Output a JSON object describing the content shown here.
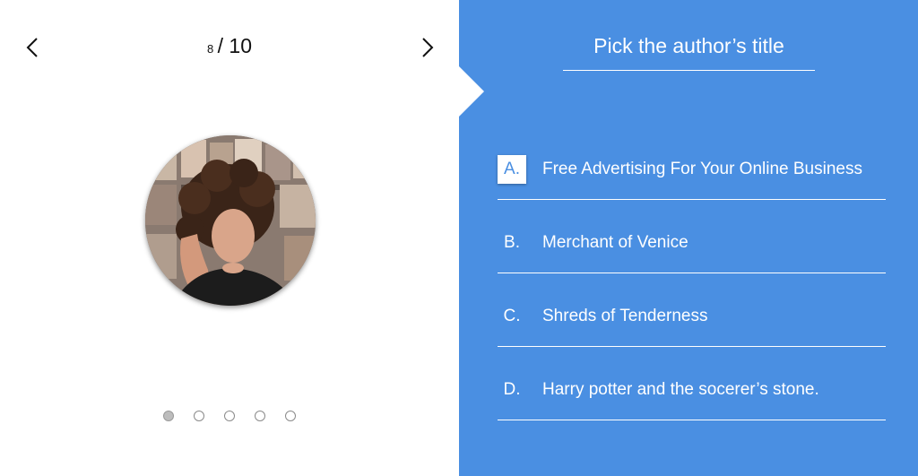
{
  "pager": {
    "current": "8",
    "total": "/ 10"
  },
  "question": {
    "title": "Pick the author’s title"
  },
  "options": [
    {
      "letter": "A.",
      "text": "Free Advertising For Your Online Business",
      "selected": true
    },
    {
      "letter": "B.",
      "text": "Merchant of Venice",
      "selected": false
    },
    {
      "letter": "C.",
      "text": "Shreds of Tenderness",
      "selected": false
    },
    {
      "letter": "D.",
      "text": "Harry potter and the socerer’s stone.",
      "selected": false
    }
  ],
  "dots": {
    "count": 5,
    "active_index": 0
  },
  "colors": {
    "accent": "#4a8fe2",
    "background": "#ffffff"
  },
  "icons": {
    "prev": "chevron-left-icon",
    "next": "chevron-right-icon"
  }
}
